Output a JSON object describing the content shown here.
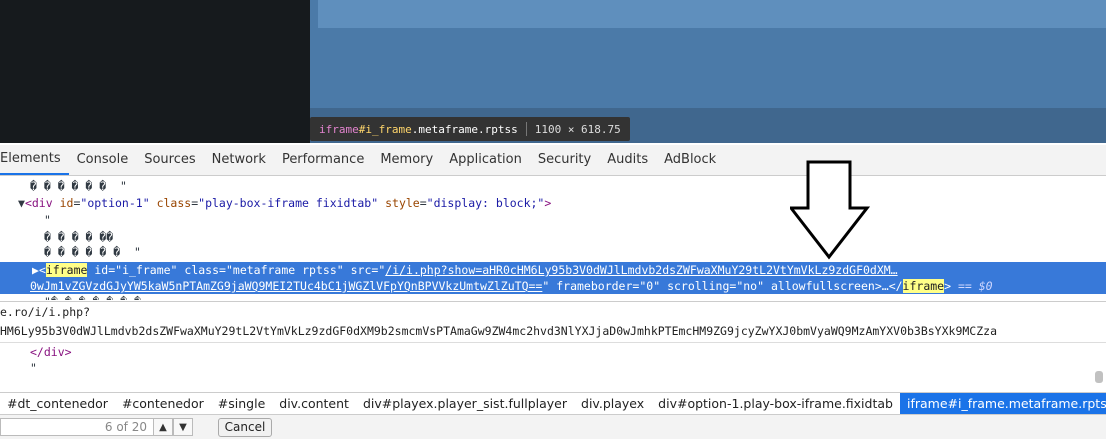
{
  "tooltip": {
    "tag": "iframe",
    "id": "#i_frame",
    "classes": ".metaframe.rptss",
    "size": "1100 × 618.75"
  },
  "tabs": [
    "Elements",
    "Console",
    "Sources",
    "Network",
    "Performance",
    "Memory",
    "Application",
    "Security",
    "Audits",
    "AdBlock"
  ],
  "dom": {
    "line1": "� � � � � �  \"",
    "div_tag": "div",
    "div_id_attr": "id",
    "div_id_val": "\"option-1\"",
    "div_class_attr": "class",
    "div_class_val": "\"play-box-iframe fixidtab\"",
    "div_style_attr": "style",
    "div_style_val": "\"display: block;\"",
    "line3": "\"",
    "line4": "� � � � ��",
    "line5": "� � � � � �  \"",
    "iframe_tag": "iframe",
    "iframe_id_attr": "id",
    "iframe_id_val": "\"i_frame\"",
    "iframe_class_attr": "class",
    "iframe_class_val": "\"metaframe rptss\"",
    "iframe_src_attr": "src",
    "iframe_src_open": "\"",
    "iframe_src_link": "/i/i.php?show=aHR0cHM6Ly95b3V0dWJlLmdvb2dsZWFwaXMuY29tL2VtYmVkLz9zdGF0dXM…",
    "iframe_src_link2": "0wJm1vZGVzdGJyYW5kaW5nPTAmZG9jaWQ9MEI2TUc4bC1jWGZlVFpYQnBPVVkzUmtwZlZuTQ==",
    "iframe_src_close": "\"",
    "frameborder_attr": "frameborder",
    "frameborder_val": "\"0\"",
    "scrolling_attr": "scrolling",
    "scrolling_val": "\"no\"",
    "allowfullscreen_attr": "allowfullscreen",
    "ellipsis": "…",
    "close_tag": "iframe",
    "dollar": "== $0",
    "line7": "\"� � � � � � �",
    "close_div": "</div>",
    "line_quote": "\""
  },
  "url_tooltip": {
    "line1": "e.ro/i/i.php?",
    "line2": "HM6Ly95b3V0dWJlLmdvb2dsZWFwaXMuY29tL2VtYmVkLz9zdGF0dXM9b2smcmVsPTAmaGw9ZW4mc2hvd3NlYXJjaD0wJmhkPTEmcHM9ZG9jcyZwYXJ0bmVyaWQ9MzAmYXV0b3BsYXk9MCZza"
  },
  "breadcrumbs": [
    "#dt_contenedor",
    "#contenedor",
    "#single",
    "div.content",
    "div#playex.player_sist.fullplayer",
    "div.playex",
    "div#option-1.play-box-iframe.fixidtab",
    "iframe#i_frame.metaframe.rptss"
  ],
  "search": {
    "value": "6 of 20",
    "prev": "▲",
    "next": "▼",
    "cancel": "Cancel"
  },
  "colors": {
    "accent": "#1a73e8",
    "selection": "#3879d9"
  }
}
